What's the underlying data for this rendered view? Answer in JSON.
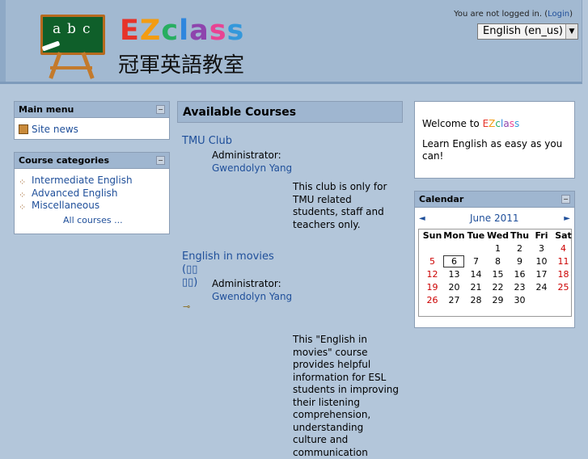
{
  "header": {
    "logo_letters": [
      "a",
      "b",
      "c"
    ],
    "logo_text": [
      {
        "ch": "E",
        "color": "#e6332a"
      },
      {
        "ch": "Z",
        "color": "#f39c12"
      },
      {
        "ch": "c",
        "color": "#27ae60"
      },
      {
        "ch": "l",
        "color": "#2e86de"
      },
      {
        "ch": "a",
        "color": "#8e44ad"
      },
      {
        "ch": "s",
        "color": "#e84393"
      },
      {
        "ch": "s",
        "color": "#3498db"
      }
    ],
    "subtitle": "冠軍英語教室",
    "login_prefix": "You are not logged in. (",
    "login_link": "Login",
    "login_suffix": ")",
    "language": "English (en_us)"
  },
  "main_menu": {
    "title": "Main menu",
    "items": [
      {
        "label": "Site news",
        "icon": "news-icon"
      }
    ]
  },
  "course_categories": {
    "title": "Course categories",
    "items": [
      "Intermediate English",
      "Advanced English",
      "Miscellaneous"
    ],
    "all_courses": "All courses ..."
  },
  "available_courses": {
    "title": "Available Courses",
    "courses": [
      {
        "name": "TMU Club",
        "role": "Administrator:",
        "admin": "Gwendolyn Yang",
        "summary": "This club is only for TMU related students, staff and teachers only."
      },
      {
        "name": "English in movies (▯▯\n▯▯)",
        "role": "Administrator:",
        "admin": "Gwendolyn Yang",
        "summary": "This \"English in movies\" course provides helpful information for ESL students in improving their listening comprehension, understanding culture and communication"
      }
    ]
  },
  "welcome": {
    "prefix": "Welcome to ",
    "brand": "EZclass",
    "text": "Learn English as easy as you can!"
  },
  "calendar": {
    "title": "Calendar",
    "month": "June 2011",
    "prev": "◄",
    "next": "►",
    "days": [
      "Sun",
      "Mon",
      "Tue",
      "Wed",
      "Thu",
      "Fri",
      "Sat"
    ],
    "weeks": [
      [
        "",
        "",
        "",
        "1",
        "2",
        "3",
        "4"
      ],
      [
        "5",
        "6",
        "7",
        "8",
        "9",
        "10",
        "11"
      ],
      [
        "12",
        "13",
        "14",
        "15",
        "16",
        "17",
        "18"
      ],
      [
        "19",
        "20",
        "21",
        "22",
        "23",
        "24",
        "25"
      ],
      [
        "26",
        "27",
        "28",
        "29",
        "30",
        "",
        ""
      ]
    ],
    "today": "6"
  }
}
